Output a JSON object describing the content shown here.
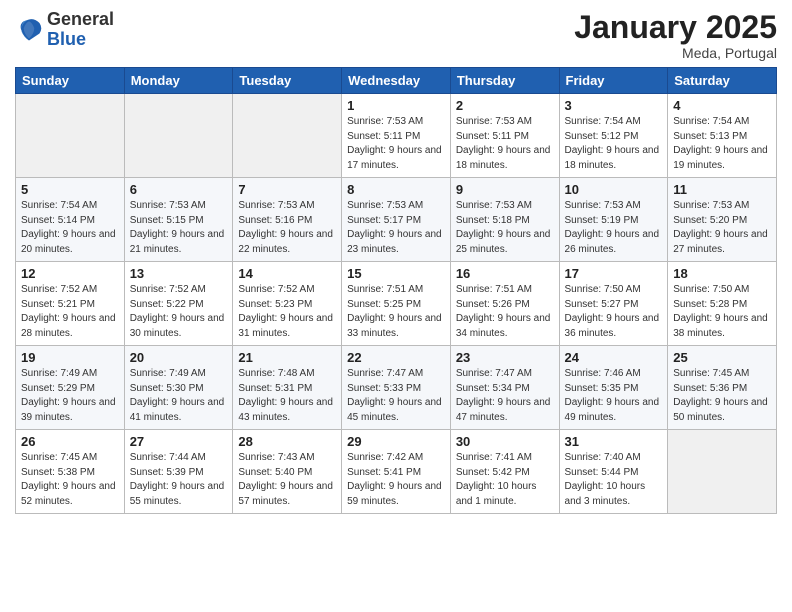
{
  "header": {
    "logo_general": "General",
    "logo_blue": "Blue",
    "month_title": "January 2025",
    "location": "Meda, Portugal"
  },
  "days_of_week": [
    "Sunday",
    "Monday",
    "Tuesday",
    "Wednesday",
    "Thursday",
    "Friday",
    "Saturday"
  ],
  "weeks": [
    [
      {
        "day": "",
        "sunrise": "",
        "sunset": "",
        "daylight": ""
      },
      {
        "day": "",
        "sunrise": "",
        "sunset": "",
        "daylight": ""
      },
      {
        "day": "",
        "sunrise": "",
        "sunset": "",
        "daylight": ""
      },
      {
        "day": "1",
        "sunrise": "Sunrise: 7:53 AM",
        "sunset": "Sunset: 5:11 PM",
        "daylight": "Daylight: 9 hours and 17 minutes."
      },
      {
        "day": "2",
        "sunrise": "Sunrise: 7:53 AM",
        "sunset": "Sunset: 5:11 PM",
        "daylight": "Daylight: 9 hours and 18 minutes."
      },
      {
        "day": "3",
        "sunrise": "Sunrise: 7:54 AM",
        "sunset": "Sunset: 5:12 PM",
        "daylight": "Daylight: 9 hours and 18 minutes."
      },
      {
        "day": "4",
        "sunrise": "Sunrise: 7:54 AM",
        "sunset": "Sunset: 5:13 PM",
        "daylight": "Daylight: 9 hours and 19 minutes."
      }
    ],
    [
      {
        "day": "5",
        "sunrise": "Sunrise: 7:54 AM",
        "sunset": "Sunset: 5:14 PM",
        "daylight": "Daylight: 9 hours and 20 minutes."
      },
      {
        "day": "6",
        "sunrise": "Sunrise: 7:53 AM",
        "sunset": "Sunset: 5:15 PM",
        "daylight": "Daylight: 9 hours and 21 minutes."
      },
      {
        "day": "7",
        "sunrise": "Sunrise: 7:53 AM",
        "sunset": "Sunset: 5:16 PM",
        "daylight": "Daylight: 9 hours and 22 minutes."
      },
      {
        "day": "8",
        "sunrise": "Sunrise: 7:53 AM",
        "sunset": "Sunset: 5:17 PM",
        "daylight": "Daylight: 9 hours and 23 minutes."
      },
      {
        "day": "9",
        "sunrise": "Sunrise: 7:53 AM",
        "sunset": "Sunset: 5:18 PM",
        "daylight": "Daylight: 9 hours and 25 minutes."
      },
      {
        "day": "10",
        "sunrise": "Sunrise: 7:53 AM",
        "sunset": "Sunset: 5:19 PM",
        "daylight": "Daylight: 9 hours and 26 minutes."
      },
      {
        "day": "11",
        "sunrise": "Sunrise: 7:53 AM",
        "sunset": "Sunset: 5:20 PM",
        "daylight": "Daylight: 9 hours and 27 minutes."
      }
    ],
    [
      {
        "day": "12",
        "sunrise": "Sunrise: 7:52 AM",
        "sunset": "Sunset: 5:21 PM",
        "daylight": "Daylight: 9 hours and 28 minutes."
      },
      {
        "day": "13",
        "sunrise": "Sunrise: 7:52 AM",
        "sunset": "Sunset: 5:22 PM",
        "daylight": "Daylight: 9 hours and 30 minutes."
      },
      {
        "day": "14",
        "sunrise": "Sunrise: 7:52 AM",
        "sunset": "Sunset: 5:23 PM",
        "daylight": "Daylight: 9 hours and 31 minutes."
      },
      {
        "day": "15",
        "sunrise": "Sunrise: 7:51 AM",
        "sunset": "Sunset: 5:25 PM",
        "daylight": "Daylight: 9 hours and 33 minutes."
      },
      {
        "day": "16",
        "sunrise": "Sunrise: 7:51 AM",
        "sunset": "Sunset: 5:26 PM",
        "daylight": "Daylight: 9 hours and 34 minutes."
      },
      {
        "day": "17",
        "sunrise": "Sunrise: 7:50 AM",
        "sunset": "Sunset: 5:27 PM",
        "daylight": "Daylight: 9 hours and 36 minutes."
      },
      {
        "day": "18",
        "sunrise": "Sunrise: 7:50 AM",
        "sunset": "Sunset: 5:28 PM",
        "daylight": "Daylight: 9 hours and 38 minutes."
      }
    ],
    [
      {
        "day": "19",
        "sunrise": "Sunrise: 7:49 AM",
        "sunset": "Sunset: 5:29 PM",
        "daylight": "Daylight: 9 hours and 39 minutes."
      },
      {
        "day": "20",
        "sunrise": "Sunrise: 7:49 AM",
        "sunset": "Sunset: 5:30 PM",
        "daylight": "Daylight: 9 hours and 41 minutes."
      },
      {
        "day": "21",
        "sunrise": "Sunrise: 7:48 AM",
        "sunset": "Sunset: 5:31 PM",
        "daylight": "Daylight: 9 hours and 43 minutes."
      },
      {
        "day": "22",
        "sunrise": "Sunrise: 7:47 AM",
        "sunset": "Sunset: 5:33 PM",
        "daylight": "Daylight: 9 hours and 45 minutes."
      },
      {
        "day": "23",
        "sunrise": "Sunrise: 7:47 AM",
        "sunset": "Sunset: 5:34 PM",
        "daylight": "Daylight: 9 hours and 47 minutes."
      },
      {
        "day": "24",
        "sunrise": "Sunrise: 7:46 AM",
        "sunset": "Sunset: 5:35 PM",
        "daylight": "Daylight: 9 hours and 49 minutes."
      },
      {
        "day": "25",
        "sunrise": "Sunrise: 7:45 AM",
        "sunset": "Sunset: 5:36 PM",
        "daylight": "Daylight: 9 hours and 50 minutes."
      }
    ],
    [
      {
        "day": "26",
        "sunrise": "Sunrise: 7:45 AM",
        "sunset": "Sunset: 5:38 PM",
        "daylight": "Daylight: 9 hours and 52 minutes."
      },
      {
        "day": "27",
        "sunrise": "Sunrise: 7:44 AM",
        "sunset": "Sunset: 5:39 PM",
        "daylight": "Daylight: 9 hours and 55 minutes."
      },
      {
        "day": "28",
        "sunrise": "Sunrise: 7:43 AM",
        "sunset": "Sunset: 5:40 PM",
        "daylight": "Daylight: 9 hours and 57 minutes."
      },
      {
        "day": "29",
        "sunrise": "Sunrise: 7:42 AM",
        "sunset": "Sunset: 5:41 PM",
        "daylight": "Daylight: 9 hours and 59 minutes."
      },
      {
        "day": "30",
        "sunrise": "Sunrise: 7:41 AM",
        "sunset": "Sunset: 5:42 PM",
        "daylight": "Daylight: 10 hours and 1 minute."
      },
      {
        "day": "31",
        "sunrise": "Sunrise: 7:40 AM",
        "sunset": "Sunset: 5:44 PM",
        "daylight": "Daylight: 10 hours and 3 minutes."
      },
      {
        "day": "",
        "sunrise": "",
        "sunset": "",
        "daylight": ""
      }
    ]
  ]
}
